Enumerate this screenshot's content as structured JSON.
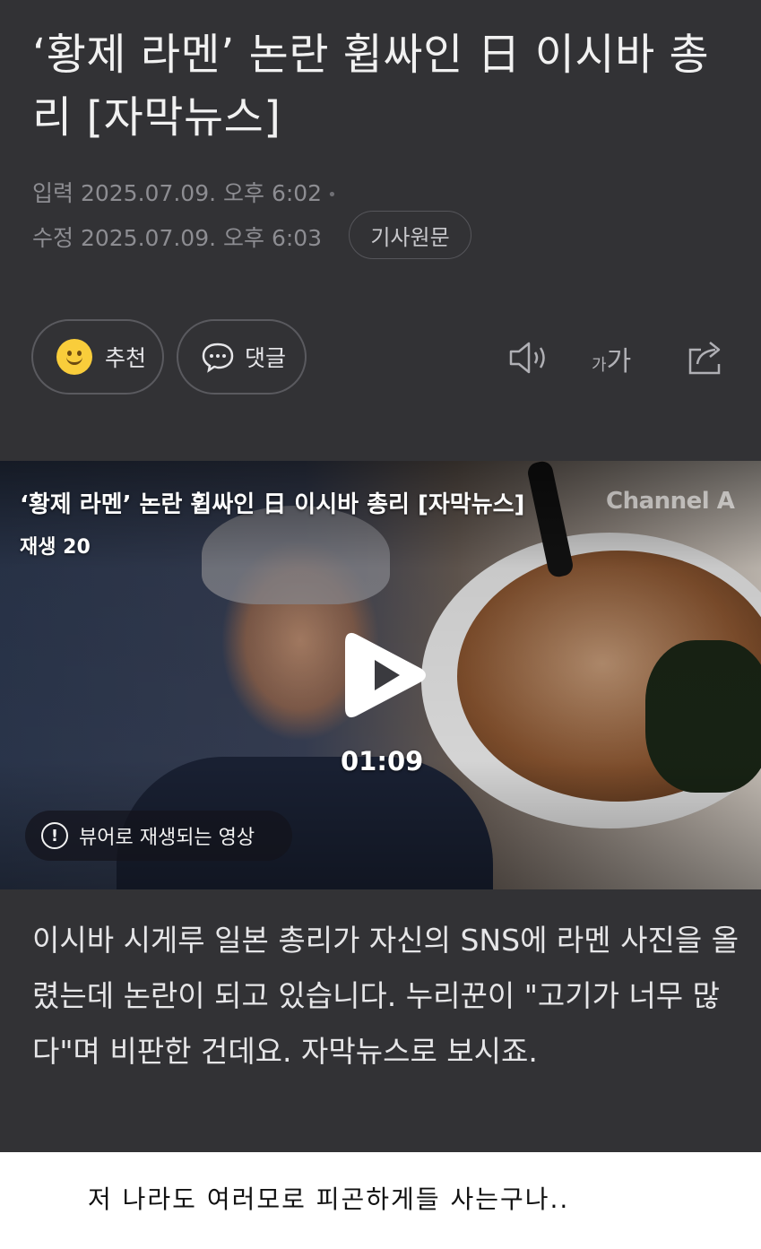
{
  "article": {
    "headline": "‘황제 라멘’ 논란 휩싸인 日 이시바 총리 [자막뉴스]",
    "published_label": "입력",
    "published": "2025.07.09. 오후 6:02",
    "modified_label": "수정",
    "modified": "2025.07.09. 오후 6:03",
    "source_button": "기사원문",
    "like_button": "추천",
    "comment_button": "댓글",
    "font_button_small": "가",
    "font_button_large": "가",
    "summary": "이시바 시게루 일본 총리가 자신의 SNS에 라멘 사진을 올렸는데 논란이 되고 있습니다. 누리꾼이 \"고기가 너무 많다\"며 비판한 건데요. 자막뉴스로 보시죠."
  },
  "video": {
    "title": "‘황제 라멘’ 논란 휩싸인 日 이시바 총리 [자막뉴스]",
    "play_count": "재생 20",
    "channel_watermark": "Channel A",
    "duration": "01:09",
    "viewer_note": "뷰어로 재생되는 영상"
  },
  "user_comment": "저 나라도 여러모로 피곤하게들 사는구나..",
  "icons": {
    "like": "smiley-icon",
    "comment": "speech-bubble-icon",
    "sound": "speaker-icon",
    "font": "font-size-icon",
    "share": "share-icon",
    "play": "play-icon",
    "info": "info-icon"
  },
  "colors": {
    "article_bg": "#323235",
    "page_bg": "#ffffff",
    "headline": "#f1f1f1",
    "meta": "#8d8d92",
    "smiley": "#f9cd3b"
  }
}
